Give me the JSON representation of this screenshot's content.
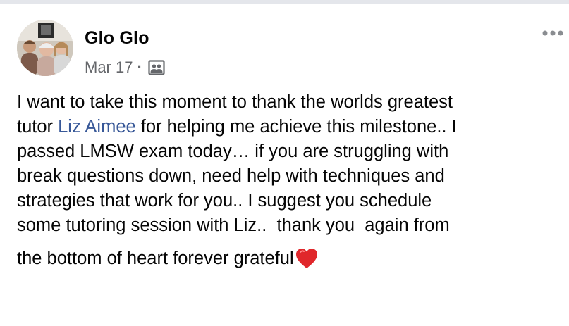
{
  "post": {
    "author": "Glo Glo",
    "date": "Mar 17",
    "separator": "·",
    "audience_icon": "friends-group-icon",
    "more_icon": "more-options-icon",
    "text": {
      "line1": "I want to take this moment to thank the worlds greatest",
      "line2_prefix": "tutor ",
      "mention": "Liz Aimee",
      "line2_suffix": " for helping me achieve this milestone.. I",
      "line3": "passed LMSW exam today… if you are struggling with",
      "line4": "break questions down, need help with techniques and",
      "line5": "strategies that work for you.. I suggest you schedule",
      "line6": "some tutoring session with Liz..  thank you  again from",
      "line7": "the bottom of heart forever grateful"
    },
    "emoji": "red-heart-icon"
  },
  "colors": {
    "mention": "#385898",
    "meta": "#65676b",
    "heart": "#e0272b"
  }
}
